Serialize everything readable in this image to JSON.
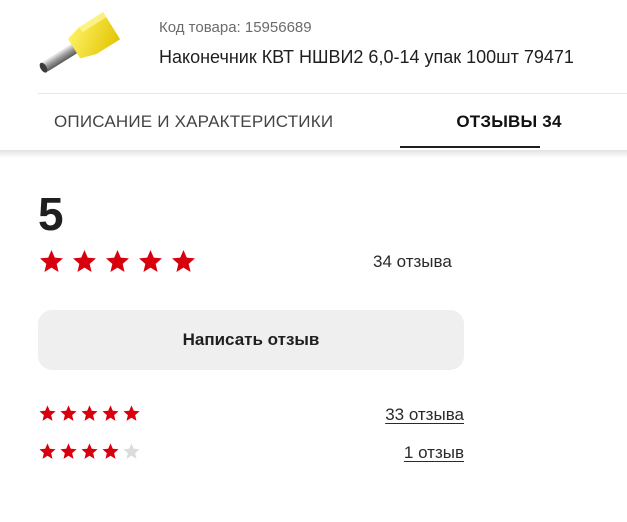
{
  "product": {
    "code_label": "Код товара: 15956689",
    "name": "Наконечник КВТ НШВИ2 6,0-14 упак 100шт 79471",
    "thumbnail_icon": "crimp-terminal-yellow"
  },
  "tabs": [
    {
      "label": "ОПИСАНИЕ И ХАРАКТЕРИСТИКИ",
      "active": false
    },
    {
      "label": "ОТЗЫВЫ 34",
      "active": true
    }
  ],
  "rating": {
    "value": "5",
    "stars": 5,
    "total_label": "34 отзыва"
  },
  "write_review_label": "Написать отзыв",
  "distribution": [
    {
      "stars": 5,
      "label": "33 отзыва"
    },
    {
      "stars": 4,
      "label": "1 отзыв"
    }
  ],
  "colors": {
    "star_filled": "#d9000d",
    "star_empty": "#dcdcdc",
    "button_bg": "#efeff0"
  }
}
